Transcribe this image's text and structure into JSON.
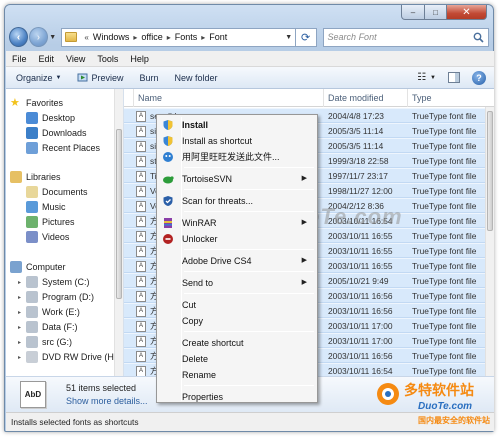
{
  "window": {
    "caption": {
      "minimize": "–",
      "maximize": "□",
      "close": "✕"
    }
  },
  "navigation": {
    "back": "‹",
    "forward": "›",
    "breadcrumb_prefix": "«",
    "breadcrumbs": [
      "Windows",
      "office",
      "Fonts",
      "Font"
    ],
    "search_placeholder": "Search Font"
  },
  "menubar": {
    "items": [
      "File",
      "Edit",
      "View",
      "Tools",
      "Help"
    ]
  },
  "commandbar": {
    "organize": "Organize",
    "preview": "Preview",
    "burn": "Burn",
    "new_folder": "New folder"
  },
  "navpane": {
    "items": [
      {
        "label": "Favorites",
        "kind": "star-icon",
        "indent": 0,
        "arrow": ""
      },
      {
        "label": "Desktop",
        "kind": "desktop-icon",
        "indent": 1,
        "arrow": ""
      },
      {
        "label": "Downloads",
        "kind": "downloads-icon",
        "indent": 1,
        "arrow": ""
      },
      {
        "label": "Recent Places",
        "kind": "recent-places-icon",
        "indent": 1,
        "arrow": ""
      },
      {
        "label": "Libraries",
        "kind": "libraries-icon",
        "indent": 0,
        "arrow": ""
      },
      {
        "label": "Documents",
        "kind": "documents-icon",
        "indent": 1,
        "arrow": ""
      },
      {
        "label": "Music",
        "kind": "music-icon",
        "indent": 1,
        "arrow": ""
      },
      {
        "label": "Pictures",
        "kind": "pictures-icon",
        "indent": 1,
        "arrow": ""
      },
      {
        "label": "Videos",
        "kind": "videos-icon",
        "indent": 1,
        "arrow": ""
      },
      {
        "label": "Computer",
        "kind": "computer-icon",
        "indent": 0,
        "arrow": ""
      },
      {
        "label": "System (C:)",
        "kind": "drive-icon",
        "indent": 1,
        "arrow": "▸"
      },
      {
        "label": "Program (D:)",
        "kind": "drive-icon",
        "indent": 1,
        "arrow": "▸"
      },
      {
        "label": "Work (E:)",
        "kind": "drive-icon",
        "indent": 1,
        "arrow": "▸"
      },
      {
        "label": "Data (F:)",
        "kind": "drive-icon",
        "indent": 1,
        "arrow": "▸"
      },
      {
        "label": "src (G:)",
        "kind": "drive-icon",
        "indent": 1,
        "arrow": "▸"
      },
      {
        "label": "DVD RW Drive (H",
        "kind": "dvd-drive-icon",
        "indent": 1,
        "arrow": "▸"
      }
    ]
  },
  "filelist": {
    "columns": {
      "name": "Name",
      "date": "Date modified",
      "type": "Type"
    },
    "rows": [
      {
        "name": "segulbk",
        "date": "2004/4/8 17:23",
        "type": "TrueType font file"
      },
      {
        "name": "si",
        "date": "2005/3/5 11:14",
        "type": "TrueType font file"
      },
      {
        "name": "si",
        "date": "2005/3/5 11:14",
        "type": "TrueType font file"
      },
      {
        "name": "st",
        "date": "1999/3/18 22:58",
        "type": "TrueType font file"
      },
      {
        "name": "Ti",
        "date": "1997/11/7 23:17",
        "type": "TrueType font file"
      },
      {
        "name": "Ve",
        "date": "1998/11/27 12:00",
        "type": "TrueType font file"
      },
      {
        "name": "Ve",
        "date": "2004/2/12 8:36",
        "type": "TrueType font file"
      },
      {
        "name": "方",
        "date": "2003/10/11 16:54",
        "type": "TrueType font file"
      },
      {
        "name": "方",
        "date": "2003/10/11 16:55",
        "type": "TrueType font file"
      },
      {
        "name": "方",
        "date": "2003/10/11 16:55",
        "type": "TrueType font file"
      },
      {
        "name": "方",
        "date": "2003/10/11 16:55",
        "type": "TrueType font file"
      },
      {
        "name": "方",
        "date": "2005/10/21 9:49",
        "type": "TrueType font file"
      },
      {
        "name": "方",
        "date": "2003/10/11 16:56",
        "type": "TrueType font file"
      },
      {
        "name": "方",
        "date": "2003/10/11 16:56",
        "type": "TrueType font file"
      },
      {
        "name": "方",
        "date": "2003/10/11 17:00",
        "type": "TrueType font file"
      },
      {
        "name": "方",
        "date": "2003/10/11 17:00",
        "type": "TrueType font file"
      },
      {
        "name": "方",
        "date": "2003/10/11 16:56",
        "type": "TrueType font file"
      },
      {
        "name": "方",
        "date": "2003/10/11 16:54",
        "type": "TrueType font file"
      }
    ]
  },
  "contextmenu": {
    "items": [
      {
        "label": "Install",
        "bold": true,
        "icon": "shield-icon",
        "submenu": false
      },
      {
        "label": "Install as shortcut",
        "bold": false,
        "icon": "shield-icon",
        "submenu": false
      },
      {
        "label": "用阿里旺旺发送此文件...",
        "bold": false,
        "icon": "aliwangwang-icon",
        "submenu": false
      },
      {
        "sep": true
      },
      {
        "label": "TortoiseSVN",
        "bold": false,
        "icon": "tortoisesvn-icon",
        "submenu": true
      },
      {
        "sep": true
      },
      {
        "label": "Scan for threats...",
        "bold": false,
        "icon": "antivirus-shield-icon",
        "submenu": false
      },
      {
        "sep": true
      },
      {
        "label": "WinRAR",
        "bold": false,
        "icon": "winrar-icon",
        "submenu": true
      },
      {
        "label": "Unlocker",
        "bold": false,
        "icon": "unlocker-icon",
        "submenu": false
      },
      {
        "sep": true
      },
      {
        "label": "Adobe Drive CS4",
        "bold": false,
        "icon": "",
        "submenu": true
      },
      {
        "sep": true
      },
      {
        "label": "Send to",
        "bold": false,
        "icon": "",
        "submenu": true
      },
      {
        "sep": true
      },
      {
        "label": "Cut",
        "bold": false,
        "icon": "",
        "submenu": false
      },
      {
        "label": "Copy",
        "bold": false,
        "icon": "",
        "submenu": false
      },
      {
        "sep": true
      },
      {
        "label": "Create shortcut",
        "bold": false,
        "icon": "",
        "submenu": false
      },
      {
        "label": "Delete",
        "bold": false,
        "icon": "",
        "submenu": false
      },
      {
        "label": "Rename",
        "bold": false,
        "icon": "",
        "submenu": false
      },
      {
        "sep": true
      },
      {
        "label": "Properties",
        "bold": false,
        "icon": "",
        "submenu": false
      }
    ],
    "submenu_arrow": "▶"
  },
  "details": {
    "preview_text": "AbD",
    "count": "51 items selected",
    "more": "Show more details..."
  },
  "statusbar": {
    "text": "Installs selected fonts as shortcuts"
  },
  "watermarks": {
    "center": "www.DuoTe.com",
    "logo_cn": "多特软件站",
    "logo_url": "DuoTe.com",
    "logo_sub": "国内最安全的软件站"
  },
  "colors": {
    "selection": "#d8e9fb",
    "accent": "#2c5e9e",
    "logo_orange": "#f58a12"
  }
}
